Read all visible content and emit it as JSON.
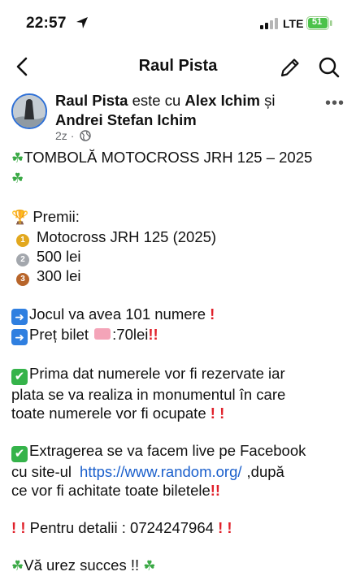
{
  "status_bar": {
    "time": "22:57",
    "network": "LTE",
    "battery": "51"
  },
  "header": {
    "title": "Raul Pista"
  },
  "post": {
    "author": "Raul Pista",
    "with_text": "este cu",
    "tagged_1": "Alex Ichim",
    "and_text": "și",
    "tagged_2": "Andrei Stefan Ichim",
    "time_ago": "2z",
    "dot": "·",
    "title": "TOMBOLĂ MOTOCROSS JRH 125 – 2025",
    "prizes_label": "Premii:",
    "prize_1": "Motocross JRH 125 (2025)",
    "prize_2": "500 lei",
    "prize_3": "300 lei",
    "info_1": "Jocul va avea 101 numere",
    "info_2_a": "Preț bilet",
    "info_2_b": ":70lei",
    "para_1_line_1": "Prima dat numerele vor fi rezervate iar",
    "para_1_line_2": "plata se va realiza in monumentul în care",
    "para_1_line_3": "toate numerele vor fi ocupate",
    "para_2_line_1": "Extragerea se va facem live pe Facebook",
    "para_2_line_2_a": "cu site-ul",
    "link": "https://www.random.org/",
    "para_2_line_2_b": ",după",
    "para_2_line_3": "ce vor fi achitate toate biletele",
    "contact": "Pentru detalii : 0724247964",
    "closing": "Vă urez succes !!"
  },
  "icons": {
    "back": "back-chevron-icon",
    "edit": "pencil-icon",
    "search": "search-icon",
    "more": "more-dots-icon",
    "privacy": "globe-icon"
  },
  "colors": {
    "link": "#1a5fcc",
    "accent_red": "#e0202a",
    "check_green": "#35b34a",
    "arrow_blue": "#2f7fe0"
  }
}
